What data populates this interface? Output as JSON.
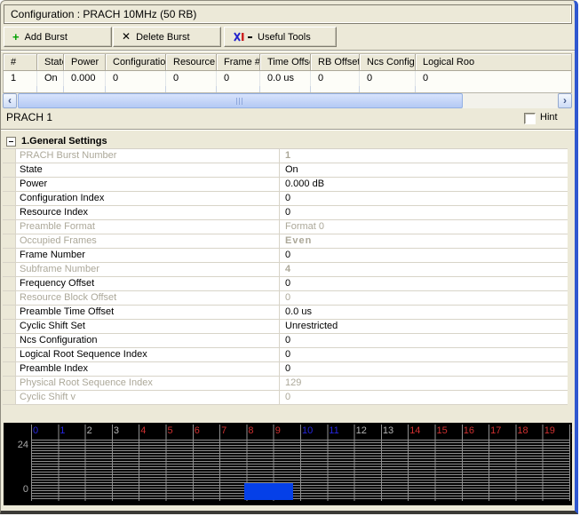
{
  "window": {
    "title": "Configuration : PRACH 10MHz (50 RB)"
  },
  "toolbar": {
    "add_burst_label": "Add Burst",
    "delete_burst_label": "Delete Burst",
    "useful_tools_label": "Useful Tools",
    "icons": {
      "add": "plus-icon",
      "delete": "x-icon",
      "tools": "tools-icon"
    }
  },
  "burst_table": {
    "columns": [
      "#",
      "State",
      "Power",
      "Configuration #",
      "Resource #",
      "Frame #",
      "Time Offset",
      "RB Offset",
      "Ncs Config.",
      "Logical Roo"
    ],
    "rows": [
      [
        "1",
        "On",
        "0.000",
        "0",
        "0",
        "0",
        "0.0 us",
        "0",
        "0",
        "0"
      ]
    ]
  },
  "scrollbar": {
    "left_arrow": "‹",
    "right_arrow": "›"
  },
  "selection": {
    "label": "PRACH 1",
    "hint_label": "Hint",
    "hint_checked": false
  },
  "settings": {
    "group_title": "1.General Settings",
    "expander_glyph": "-",
    "rows": [
      {
        "label": "PRACH Burst Number",
        "value": "1",
        "disabled": true,
        "bold": true
      },
      {
        "label": "State",
        "value": "On",
        "disabled": false,
        "bold": false
      },
      {
        "label": "Power",
        "value": "0.000 dB",
        "disabled": false,
        "bold": false
      },
      {
        "label": "Configuration Index",
        "value": "0",
        "disabled": false,
        "bold": false
      },
      {
        "label": "Resource Index",
        "value": "0",
        "disabled": false,
        "bold": false
      },
      {
        "label": "Preamble Format",
        "value": "Format 0",
        "disabled": true,
        "bold": false
      },
      {
        "label": "Occupied Frames",
        "value": "Even",
        "disabled": true,
        "bold": true
      },
      {
        "label": "Frame Number",
        "value": "0",
        "disabled": false,
        "bold": false
      },
      {
        "label": "Subframe Number",
        "value": "4",
        "disabled": true,
        "bold": true
      },
      {
        "label": "Frequency Offset",
        "value": "0",
        "disabled": false,
        "bold": false
      },
      {
        "label": "Resource Block Offset",
        "value": "0",
        "disabled": true,
        "bold": false
      },
      {
        "label": "Preamble Time Offset",
        "value": "0.0 us",
        "disabled": false,
        "bold": false
      },
      {
        "label": "Cyclic Shift Set",
        "value": "Unrestricted",
        "disabled": false,
        "bold": false
      },
      {
        "label": "Ncs Configuration",
        "value": "0",
        "disabled": false,
        "bold": false
      },
      {
        "label": "Logical Root Sequence Index",
        "value": "0",
        "disabled": false,
        "bold": false
      },
      {
        "label": "Preamble Index",
        "value": "0",
        "disabled": false,
        "bold": false
      },
      {
        "label": "Physical Root Sequence Index",
        "value": "129",
        "disabled": true,
        "bold": false
      },
      {
        "label": "Cyclic Shift v",
        "value": "0",
        "disabled": true,
        "bold": false
      }
    ]
  },
  "timeline": {
    "axis_top_label": "24",
    "axis_bottom_label": "0",
    "subframe_labels": [
      {
        "text": "0",
        "color": "blue"
      },
      {
        "text": "1",
        "color": "blue"
      },
      {
        "text": "2",
        "color": "gray"
      },
      {
        "text": "3",
        "color": "gray"
      },
      {
        "text": "4",
        "color": "red"
      },
      {
        "text": "5",
        "color": "red"
      },
      {
        "text": "6",
        "color": "red"
      },
      {
        "text": "7",
        "color": "red"
      },
      {
        "text": "8",
        "color": "red"
      },
      {
        "text": "9",
        "color": "red"
      },
      {
        "text": "10",
        "color": "blue"
      },
      {
        "text": "11",
        "color": "blue"
      },
      {
        "text": "12",
        "color": "gray"
      },
      {
        "text": "13",
        "color": "gray"
      },
      {
        "text": "14",
        "color": "red"
      },
      {
        "text": "15",
        "color": "red"
      },
      {
        "text": "16",
        "color": "red"
      },
      {
        "text": "17",
        "color": "red"
      },
      {
        "text": "18",
        "color": "red"
      },
      {
        "text": "19",
        "color": "red"
      }
    ],
    "clipped_label": {
      "text": "2",
      "color": "blue"
    },
    "burst_block_color": "#0540E8"
  },
  "colors": {
    "background": "#ECE9D8",
    "window_border_right": "#2F57CF",
    "disabled_text": "#ACA899",
    "subframe_blue": "#2626DD",
    "subframe_red": "#D03030",
    "subframe_gray": "#B5B5B5"
  }
}
